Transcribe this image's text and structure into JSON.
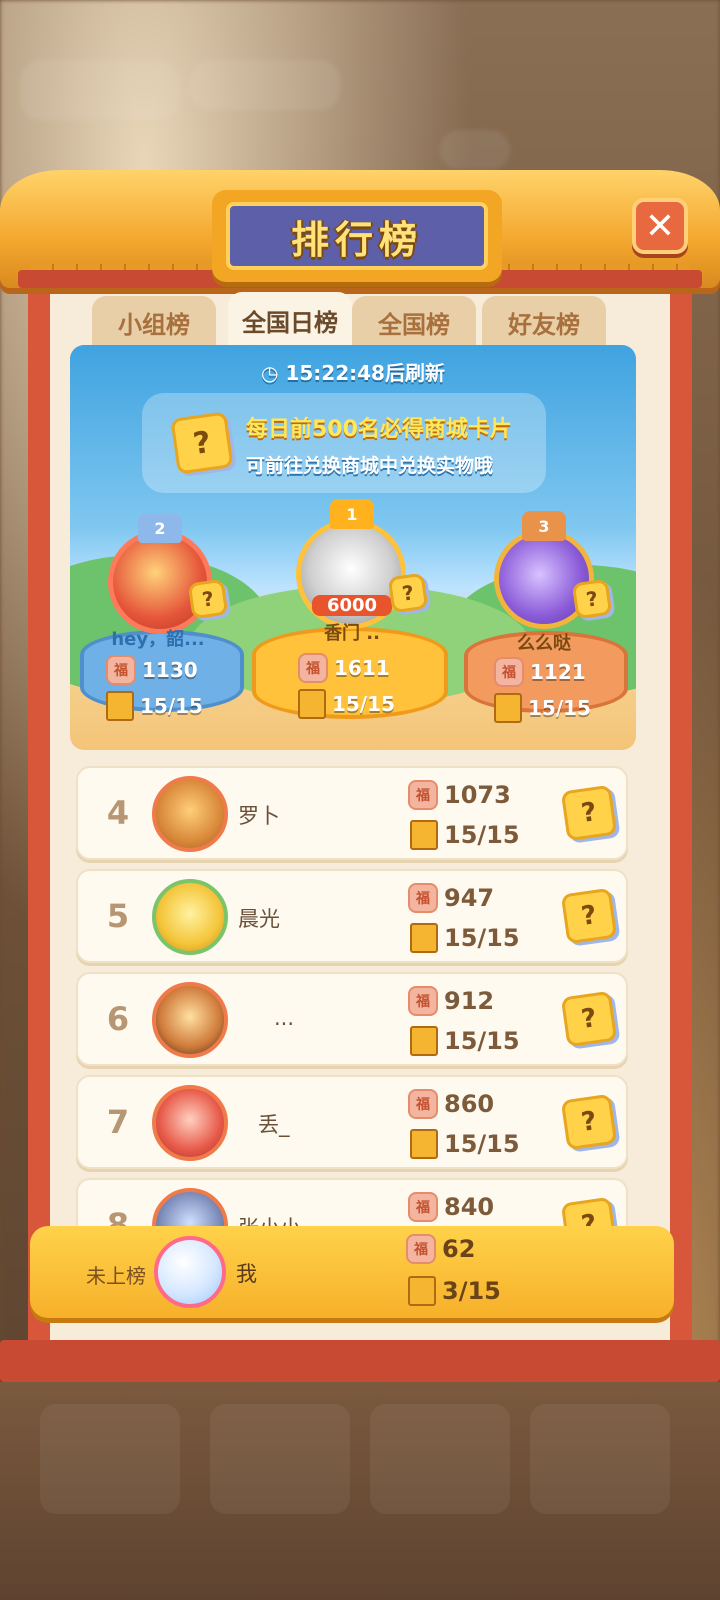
{
  "header": {
    "title": "排行榜",
    "close_label": "✕"
  },
  "tabs": [
    {
      "label": "小组榜",
      "active": false
    },
    {
      "label": "全国日榜",
      "active": true
    },
    {
      "label": "全国榜",
      "active": false
    },
    {
      "label": "好友榜",
      "active": false
    }
  ],
  "banner": {
    "refresh": "15:22:48后刷新",
    "info_line1": "每日前500名必得商城卡片",
    "info_line2": "可前往兑换商城中兑换实物哦",
    "card_glyph": "?"
  },
  "podium": {
    "first": {
      "rank": "1",
      "name": "香门 ..",
      "score": "1611",
      "books": "15/15",
      "badge": "6000"
    },
    "second": {
      "rank": "2",
      "name": "hey，韶...",
      "score": "1130",
      "books": "15/15"
    },
    "third": {
      "rank": "3",
      "name": "么么哒",
      "score": "1121",
      "books": "15/15"
    }
  },
  "icons": {
    "coin": "福",
    "book": ""
  },
  "list": [
    {
      "rank": "4",
      "name": "罗卜",
      "score": "1073",
      "books": "15/15"
    },
    {
      "rank": "5",
      "name": "晨光",
      "score": "947",
      "books": "15/15"
    },
    {
      "rank": "6",
      "name": "...",
      "score": "912",
      "books": "15/15"
    },
    {
      "rank": "7",
      "name": "丢_",
      "score": "860",
      "books": "15/15"
    },
    {
      "rank": "8",
      "name": "张小小",
      "score": "840",
      "books": ""
    }
  ],
  "me": {
    "status": "未上榜",
    "name": "我",
    "score": "62",
    "books": "3/15"
  },
  "colors": {
    "accent": "#f3a623",
    "frame": "#d8563a",
    "plaque": "#5d5fa8"
  }
}
